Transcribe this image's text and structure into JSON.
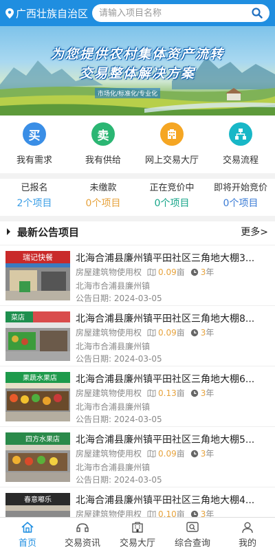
{
  "header": {
    "location": "广西壮族自治区",
    "search_placeholder": "请输入项目名称",
    "location_icon": "map-pin-icon",
    "search_icon": "search-icon"
  },
  "banner": {
    "line1": "为您提供农村集体资产流转",
    "line2": "交易整体解决方案",
    "tagline": "市场化/标准化/专业化"
  },
  "quick_links": [
    {
      "label": "我有需求",
      "glyph": "买",
      "color": "#3a8ee6",
      "icon": "buy-icon"
    },
    {
      "label": "我有供给",
      "glyph": "卖",
      "color": "#2bb673",
      "icon": "sell-icon"
    },
    {
      "label": "网上交易大厅",
      "glyph": "",
      "color": "#f5a623",
      "icon": "building-icon"
    },
    {
      "label": "交易流程",
      "glyph": "",
      "color": "#18b7c7",
      "icon": "flowchart-icon"
    }
  ],
  "stats": [
    {
      "label": "已报名",
      "value": "2个项目",
      "color": "#3a9ee6"
    },
    {
      "label": "未缴款",
      "value": "0个项目",
      "color": "#e6a23c"
    },
    {
      "label": "正在竞价中",
      "value": "0个项目",
      "color": "#17a589"
    },
    {
      "label": "即将开始竞价",
      "value": "0个项目",
      "color": "#3a7bd5"
    }
  ],
  "section": {
    "title": "最新公告项目",
    "more": "更多>"
  },
  "listings": [
    {
      "title": "北海合浦县廉州镇平田社区三角地大棚3...",
      "type": "房屋建筑物使用权",
      "area": "0.09",
      "area_unit": "亩",
      "years": "3",
      "years_unit": "年",
      "address": "北海市合浦县廉州镇",
      "date": "公告日期: 2024-03-05",
      "sign": "瑞记快餐"
    },
    {
      "title": "北海合浦县廉州镇平田社区三角地大棚8...",
      "type": "房屋建筑物使用权",
      "area": "0.09",
      "area_unit": "亩",
      "years": "3",
      "years_unit": "年",
      "address": "北海市合浦县廉州镇",
      "date": "公告日期: 2024-03-05",
      "sign": "菜店"
    },
    {
      "title": "北海合浦县廉州镇平田社区三角地大棚6...",
      "type": "房屋建筑物使用权",
      "area": "0.13",
      "area_unit": "亩",
      "years": "3",
      "years_unit": "年",
      "address": "北海市合浦县廉州镇",
      "date": "公告日期: 2024-03-05",
      "sign": "果蔬水果店"
    },
    {
      "title": "北海合浦县廉州镇平田社区三角地大棚5...",
      "type": "房屋建筑物使用权",
      "area": "0.09",
      "area_unit": "亩",
      "years": "3",
      "years_unit": "年",
      "address": "北海市合浦县廉州镇",
      "date": "公告日期: 2024-03-05",
      "sign": "四方水果店"
    },
    {
      "title": "北海合浦县廉州镇平田社区三角地大棚4...",
      "type": "房屋建筑物使用权",
      "area": "0.10",
      "area_unit": "亩",
      "years": "3",
      "years_unit": "年",
      "address": "",
      "date": "",
      "sign": "春意嘟乐"
    }
  ],
  "nav": [
    {
      "label": "首页",
      "icon": "home-icon",
      "active": true
    },
    {
      "label": "交易资讯",
      "icon": "news-icon",
      "active": false
    },
    {
      "label": "交易大厅",
      "icon": "hall-icon",
      "active": false
    },
    {
      "label": "综合查询",
      "icon": "query-icon",
      "active": false
    },
    {
      "label": "我的",
      "icon": "user-icon",
      "active": false
    }
  ]
}
